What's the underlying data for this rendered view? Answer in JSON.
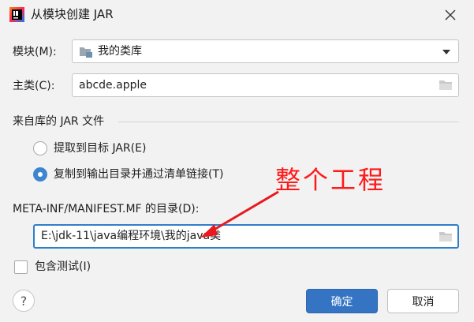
{
  "window": {
    "title": "从模块创建 JAR",
    "app_icon": "intellij-icon",
    "close_icon": "close-icon"
  },
  "module": {
    "label": "模块(M):",
    "value": "我的类库",
    "icon": "module-folder-icon",
    "dropdown_icon": "chevron-down-icon"
  },
  "main_class": {
    "label": "主类(C):",
    "value": "abcde.apple",
    "browse_icon": "folder-icon"
  },
  "jar_section": {
    "header": "来自库的 JAR 文件",
    "options": [
      {
        "label": "提取到目标 JAR(E)",
        "selected": false
      },
      {
        "label": "复制到输出目录并通过清单链接(T)",
        "selected": true
      }
    ]
  },
  "manifest": {
    "label": "META-INF/MANIFEST.MF 的目录(D):",
    "value": "E:\\jdk-11\\java编程环境\\我的java类",
    "browse_icon": "folder-icon"
  },
  "include_tests": {
    "label": "包含测试(I)",
    "checked": false
  },
  "annotation": {
    "text": "整个工程",
    "color": "#ff1a1a"
  },
  "buttons": {
    "help": "?",
    "ok": "确定",
    "cancel": "取消"
  },
  "colors": {
    "accent": "#3574c3",
    "radio_selected": "#3d86cf",
    "focus_border": "#2f7ecb"
  }
}
